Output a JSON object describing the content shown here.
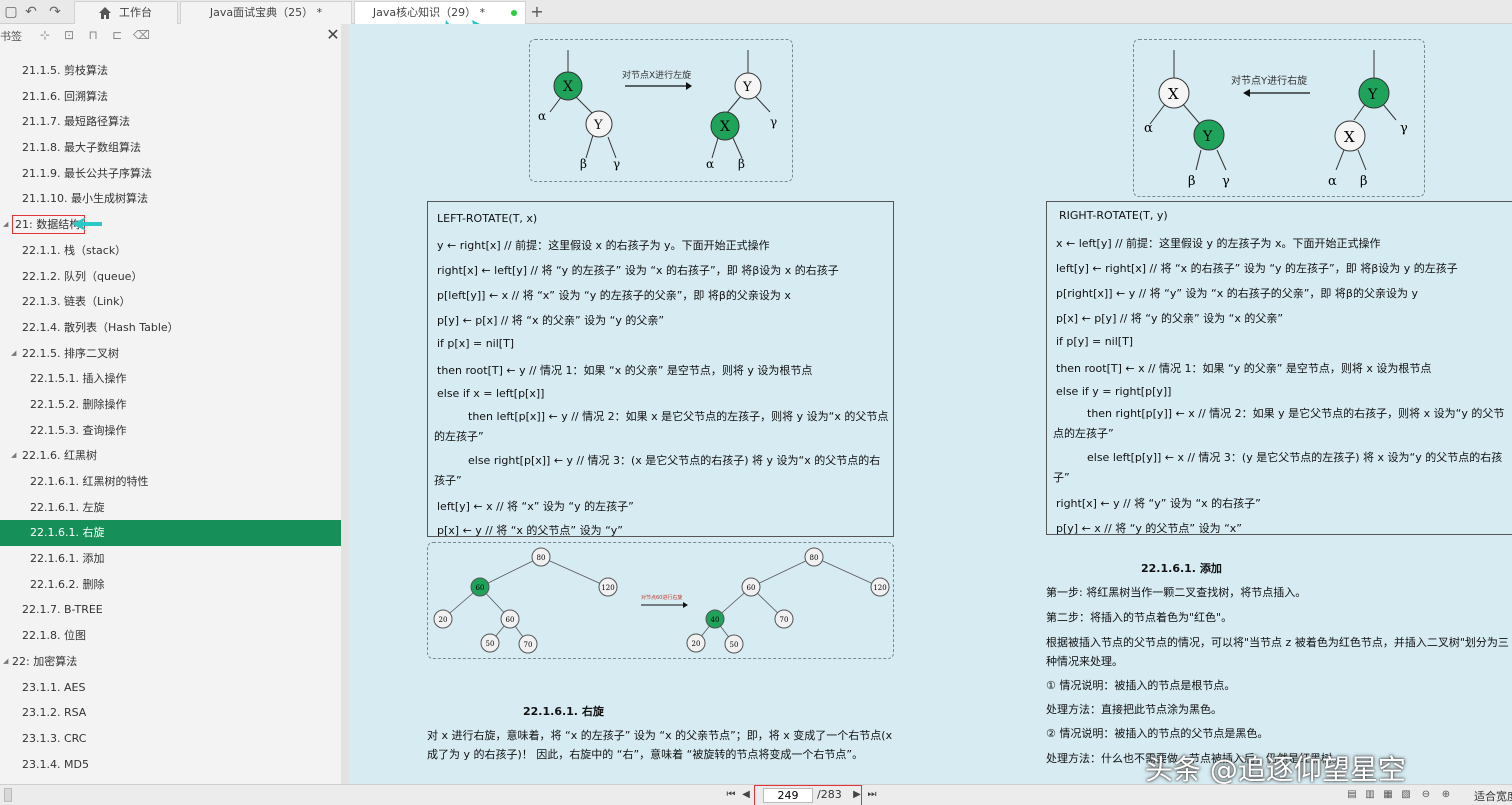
{
  "tabs": [
    {
      "label": "工作台"
    },
    {
      "label": "Java面试宝典（25） *"
    },
    {
      "label": "Java核心知识（29） *"
    }
  ],
  "sidebar": {
    "title": "书签",
    "items": [
      {
        "label": "21.1.5. 剪枝算法"
      },
      {
        "label": "21.1.6. 回溯算法"
      },
      {
        "label": "21.1.7. 最短路径算法"
      },
      {
        "label": "21.1.8. 最大子数组算法"
      },
      {
        "label": "21.1.9. 最长公共子序算法"
      },
      {
        "label": "21.1.10. 最小生成树算法"
      },
      {
        "label": "21: 数据结构"
      },
      {
        "label": "22.1.1. 栈（stack）"
      },
      {
        "label": "22.1.2. 队列（queue）"
      },
      {
        "label": "22.1.3. 链表（Link）"
      },
      {
        "label": "22.1.4. 散列表（Hash Table）"
      },
      {
        "label": "22.1.5. 排序二叉树"
      },
      {
        "label": "22.1.5.1. 插入操作"
      },
      {
        "label": "22.1.5.2. 删除操作"
      },
      {
        "label": "22.1.5.3. 查询操作"
      },
      {
        "label": "22.1.6. 红黑树"
      },
      {
        "label": "22.1.6.1. 红黑树的特性"
      },
      {
        "label": "22.1.6.1. 左旋"
      },
      {
        "label": "22.1.6.1. 右旋"
      },
      {
        "label": "22.1.6.1. 添加"
      },
      {
        "label": "22.1.6.2. 删除"
      },
      {
        "label": "22.1.7. B-TREE"
      },
      {
        "label": "22.1.8. 位图"
      },
      {
        "label": "22: 加密算法"
      },
      {
        "label": "23.1.1. AES"
      },
      {
        "label": "23.1.2. RSA"
      },
      {
        "label": "23.1.3. CRC"
      },
      {
        "label": "23.1.4. MD5"
      }
    ]
  },
  "doc": {
    "diag_left_caption": "对节点X进行左旋",
    "diag_right_caption": "对节点Y进行右旋",
    "diag_bottom_caption": "对节点60进行右旋",
    "node_x": "X",
    "node_y": "Y",
    "alpha": "α",
    "beta": "β",
    "gamma": "γ",
    "nodes_bottom": [
      "80",
      "60",
      "120",
      "20",
      "60",
      "50",
      "70",
      "80",
      "60",
      "120",
      "40",
      "70",
      "20",
      "50"
    ],
    "left_code": [
      "LEFT-ROTATE(T, x)",
      "y ← right[x]            // 前提：这里假设 x 的右孩子为 y。下面开始正式操作",
      "right[x] ← left[y]      // 将 “y 的左孩子” 设为 “x 的右孩子”，即 将β设为 x 的右孩子",
      "p[left[y]] ← x          // 将 “x” 设为 “y 的左孩子的父亲”，即 将β的父亲设为 x",
      "p[y] ← p[x]             // 将 “x 的父亲” 设为 “y 的父亲”",
      "if p[x] = nil[T]",
      "then root[T] ← y                 // 情况 1：如果 “x 的父亲” 是空节点，则将 y 设为根节点",
      "else if x = left[p[x]]",
      "then left[p[x]] ← y    // 情况 2：如果 x 是它父节点的左孩子，则将 y 设为“x 的父节点的左孩子”",
      "else right[p[x]] ← y   // 情况 3：(x 是它父节点的右孩子) 将 y 设为“x 的父节点的右孩子”",
      "left[y] ← x             // 将 “x” 设为 “y 的左孩子”",
      "p[x] ← y                // 将 “x 的父节点” 设为 “y”"
    ],
    "right_code": [
      "RIGHT-ROTATE(T, y)",
      "x ← left[y]             // 前提：这里假设 y 的左孩子为 x。下面开始正式操作",
      "left[y] ← right[x]      // 将 “x 的右孩子” 设为 “y 的左孩子”，即 将β设为 y 的左孩子",
      "p[right[x]] ← y         // 将 “y” 设为 “x 的右孩子的父亲”，即 将β的父亲设为 y",
      "p[x] ← p[y]             // 将 “y 的父亲” 设为 “x 的父亲”",
      "if p[y] = nil[T]",
      "then root[T] ← x                 // 情况 1：如果 “y 的父亲” 是空节点，则将 x 设为根节点",
      "else if y = right[p[y]]",
      "then right[p[y]] ← x   // 情况 2：如果 y 是它父节点的右孩子，则将 x 设为“y 的父节点的左孩子”",
      "else left[p[y]] ← x    // 情况 3：(y 是它父节点的左孩子) 将 x 设为“y 的父节点的右孩子”",
      "right[x] ← y            // 将 “y” 设为 “x 的右孩子”",
      "p[y] ← x                // 将 “y 的父节点” 设为 “x”"
    ],
    "right_rotate_heading": "22.1.6.1.    右旋",
    "right_rotate_text_1": "对 x 进行右旋，意味着，将 “x 的左孩子” 设为 “x 的父亲节点”；即，将 x 变成了一个右节点(x",
    "right_rotate_text_2": "成了为 y 的右孩子)！ 因此，右旋中的 “右”，意味着 “被旋转的节点将变成一个右节点”。",
    "add_heading": "22.1.6.1.    添加",
    "add_text": [
      "第一步: 将红黑树当作一颗二叉查找树，将节点插入。",
      "第二步：将插入的节点着色为\"红色\"。",
      "  根据被插入节点的父节点的情况，可以将\"当节点 z 被着色为红色节点，并插入二叉树\"划分为三",
      "种情况来处理。",
      "① 情况说明：被插入的节点是根节点。",
      "处理方法：直接把此节点涂为黑色。",
      "② 情况说明：被插入的节点的父节点是黑色。",
      "处理方法：什么也不需要做。节点被插入后，仍然是红黑树。"
    ]
  },
  "status": {
    "page_current": "249",
    "page_total": "/283",
    "zoom_label": "适合宽度"
  },
  "watermark": "头条 @追逐仰望星空",
  "colors": {
    "accent": "#168f58",
    "node_green": "#1fa35a",
    "highlight_red": "#e0343a",
    "doc_bg": "#d6ecf2",
    "annotation_arrow": "#2bc8c8"
  }
}
